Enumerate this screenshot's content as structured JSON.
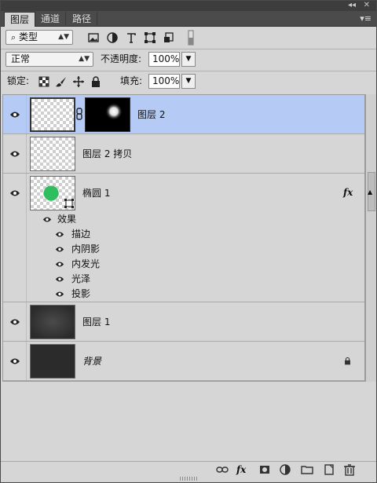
{
  "tabs": [
    {
      "label": "图层",
      "active": true
    },
    {
      "label": "通道",
      "active": false
    },
    {
      "label": "路径",
      "active": false
    }
  ],
  "filter": {
    "kind": "类型",
    "icons": [
      "image-filter-icon",
      "adjustment-filter-icon",
      "text-filter-icon",
      "shape-filter-icon",
      "smart-object-filter-icon",
      "filter-toggle-icon"
    ]
  },
  "blend": {
    "mode": "正常",
    "opacity_label": "不透明度:",
    "opacity_value": "100%"
  },
  "lock": {
    "label": "锁定:",
    "fill_label": "填充:",
    "fill_value": "100%"
  },
  "layers": [
    {
      "name": "图层 2",
      "selected": true,
      "thumb": "transparent",
      "mask": "white-glow",
      "linked": true
    },
    {
      "name": "图层 2 拷贝",
      "selected": false,
      "thumb": "transparent"
    },
    {
      "name": "椭圆 1",
      "selected": false,
      "thumb": "green-circle",
      "fx_label": "fx",
      "effects_label": "效果",
      "effects": [
        "描边",
        "内阴影",
        "内发光",
        "光泽",
        "投影"
      ]
    },
    {
      "name": "图层 1",
      "selected": false,
      "thumb": "dark-vignette"
    },
    {
      "name": "背景",
      "selected": false,
      "thumb": "dark",
      "locked": true
    }
  ],
  "bottom_icons": [
    "link-layers-icon",
    "add-style-icon",
    "add-mask-icon",
    "adjustment-layer-icon",
    "group-folder-icon",
    "new-layer-icon",
    "trash-icon"
  ],
  "fx_bottom_label": "fx",
  "colors": {
    "selected_bg": "#b5cbf5",
    "panel_bg": "#d6d6d6",
    "circle": "#2dbe5f"
  }
}
